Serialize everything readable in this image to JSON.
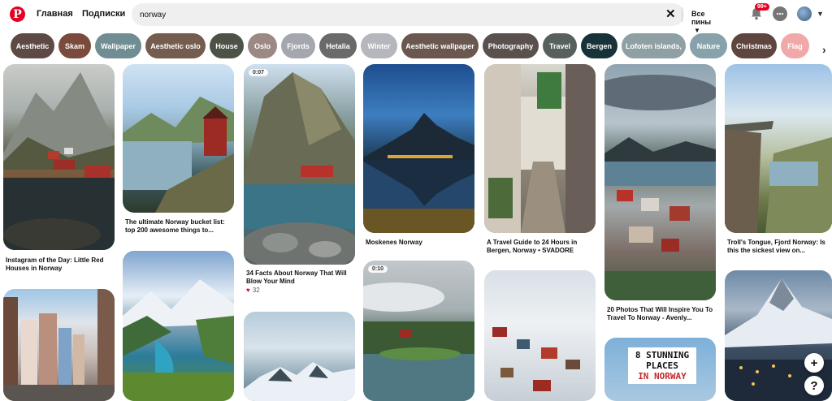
{
  "header": {
    "logo_letter": "P",
    "nav_home": "Главная",
    "nav_subscriptions": "Подписки",
    "search_value": "norway",
    "filter_label": "Все пины",
    "notification_badge": "99+"
  },
  "chips": [
    {
      "label": "Aesthetic",
      "color": "#5d4a45"
    },
    {
      "label": "Skam",
      "color": "#7a4b3d"
    },
    {
      "label": "Wallpaper",
      "color": "#6f8d92"
    },
    {
      "label": "Aesthetic oslo",
      "color": "#745d4f"
    },
    {
      "label": "House",
      "color": "#4d5247"
    },
    {
      "label": "Oslo",
      "color": "#9c8984"
    },
    {
      "label": "Fjords",
      "color": "#a4a8ae"
    },
    {
      "label": "Hetalia",
      "color": "#6b6a6a"
    },
    {
      "label": "Winter",
      "color": "#b5b7bd"
    },
    {
      "label": "Aesthetic wallpaper",
      "color": "#6a5750"
    },
    {
      "label": "Photography",
      "color": "#5a514e"
    },
    {
      "label": "Travel",
      "color": "#57605c"
    },
    {
      "label": "Bergen",
      "color": "#173238"
    },
    {
      "label": "Lofoten islands,",
      "color": "#8fa0a4"
    },
    {
      "label": "Nature",
      "color": "#88a2ab"
    },
    {
      "label": "Christmas",
      "color": "#5e453d"
    },
    {
      "label": "Flag",
      "color": "#f0a8a8"
    }
  ],
  "pins": [
    {
      "caption": "Instagram of the Day: Little Red Houses in Norway"
    },
    {
      "caption": "The ultimate Norway bucket list: top 200 awesome things to..."
    },
    {
      "caption": "34 Facts About Norway That Will Blow Your Mind",
      "video": "0:07",
      "likes": "32"
    },
    {
      "caption": "Moskenes Norway"
    },
    {
      "caption": "A Travel Guide to 24 Hours in Bergen, Norway • SVADORE"
    },
    {
      "caption": "20 Photos That Will Inspire You To Travel To Norway - Avenly..."
    },
    {
      "caption": "Troll's Tongue, Fjord Norway: Is this the sickest view on..."
    },
    {
      "video": "0:10"
    },
    {
      "title_lines": [
        "8 STUNNING",
        "PLACES",
        "IN NORWAY"
      ]
    }
  ],
  "floating": {
    "add": "+",
    "help": "?"
  }
}
